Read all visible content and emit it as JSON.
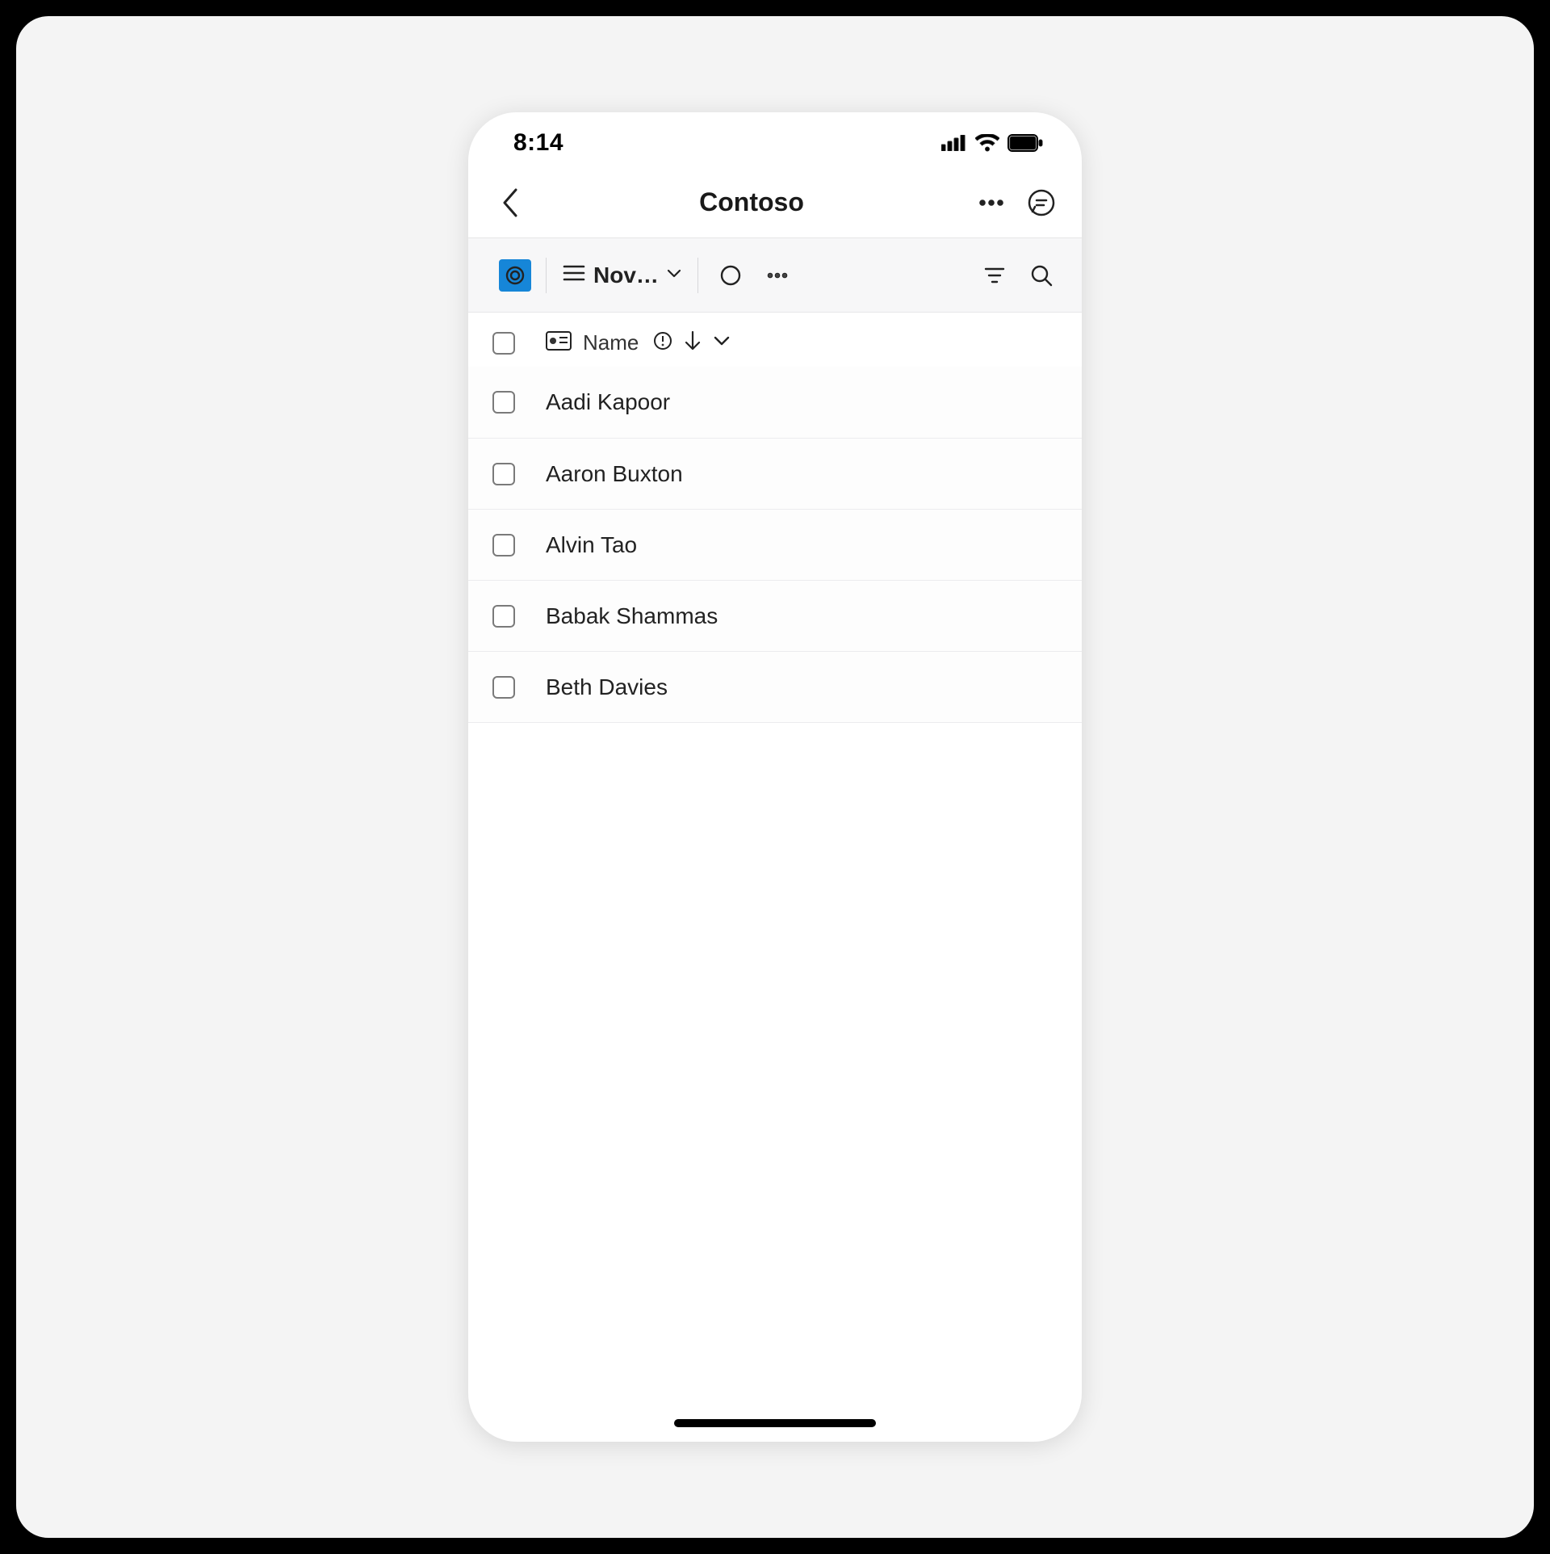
{
  "statusbar": {
    "time": "8:14"
  },
  "nav": {
    "title": "Contoso"
  },
  "toolbar": {
    "view_label": "Nov…"
  },
  "table": {
    "header_label": "Name",
    "rows": [
      {
        "name": "Aadi Kapoor"
      },
      {
        "name": "Aaron Buxton"
      },
      {
        "name": "Alvin Tao"
      },
      {
        "name": "Babak Shammas"
      },
      {
        "name": "Beth Davies"
      }
    ]
  }
}
